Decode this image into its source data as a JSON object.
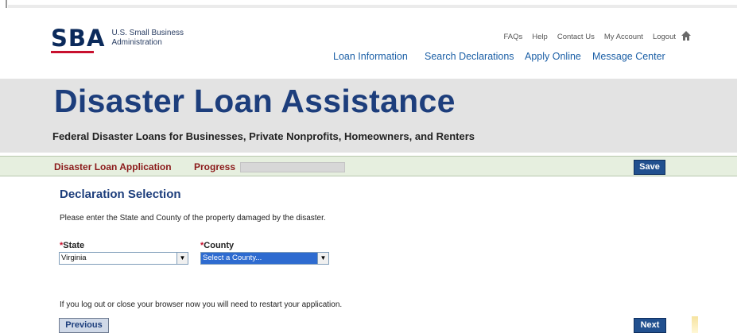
{
  "header": {
    "logo_mark": "SBA",
    "logo_line1": "U.S. Small Business",
    "logo_line2": "Administration",
    "util_links": [
      "FAQs",
      "Help",
      "Contact Us",
      "My Account",
      "Logout"
    ],
    "home_icon": "home-icon",
    "nav": [
      "Loan Information",
      "Search Declarations",
      "Apply Online",
      "Message Center"
    ]
  },
  "banner": {
    "title": "Disaster Loan Assistance",
    "subtitle": "Federal Disaster Loans for Businesses, Private Nonprofits, Homeowners, and Renters"
  },
  "app_bar": {
    "title": "Disaster Loan Application",
    "progress_label": "Progress",
    "progress_value": 0,
    "save_label": "Save"
  },
  "content": {
    "section_title": "Declaration Selection",
    "instructions": "Please enter the State and County of the property damaged by the disaster.",
    "required_marker": "*",
    "state_label": "State",
    "state_value": "Virginia",
    "county_label": "County",
    "county_value": "Select a County...",
    "notice": "If you log out or close your browser now you will need to restart your application."
  },
  "footer": {
    "previous_label": "Previous",
    "next_label": "Next"
  },
  "colors": {
    "brand_navy": "#1d3e7c",
    "brand_red": "#c8102e",
    "nav_link": "#1b5fa6",
    "app_title": "#8b1a1a",
    "button_blue": "#21508f"
  }
}
